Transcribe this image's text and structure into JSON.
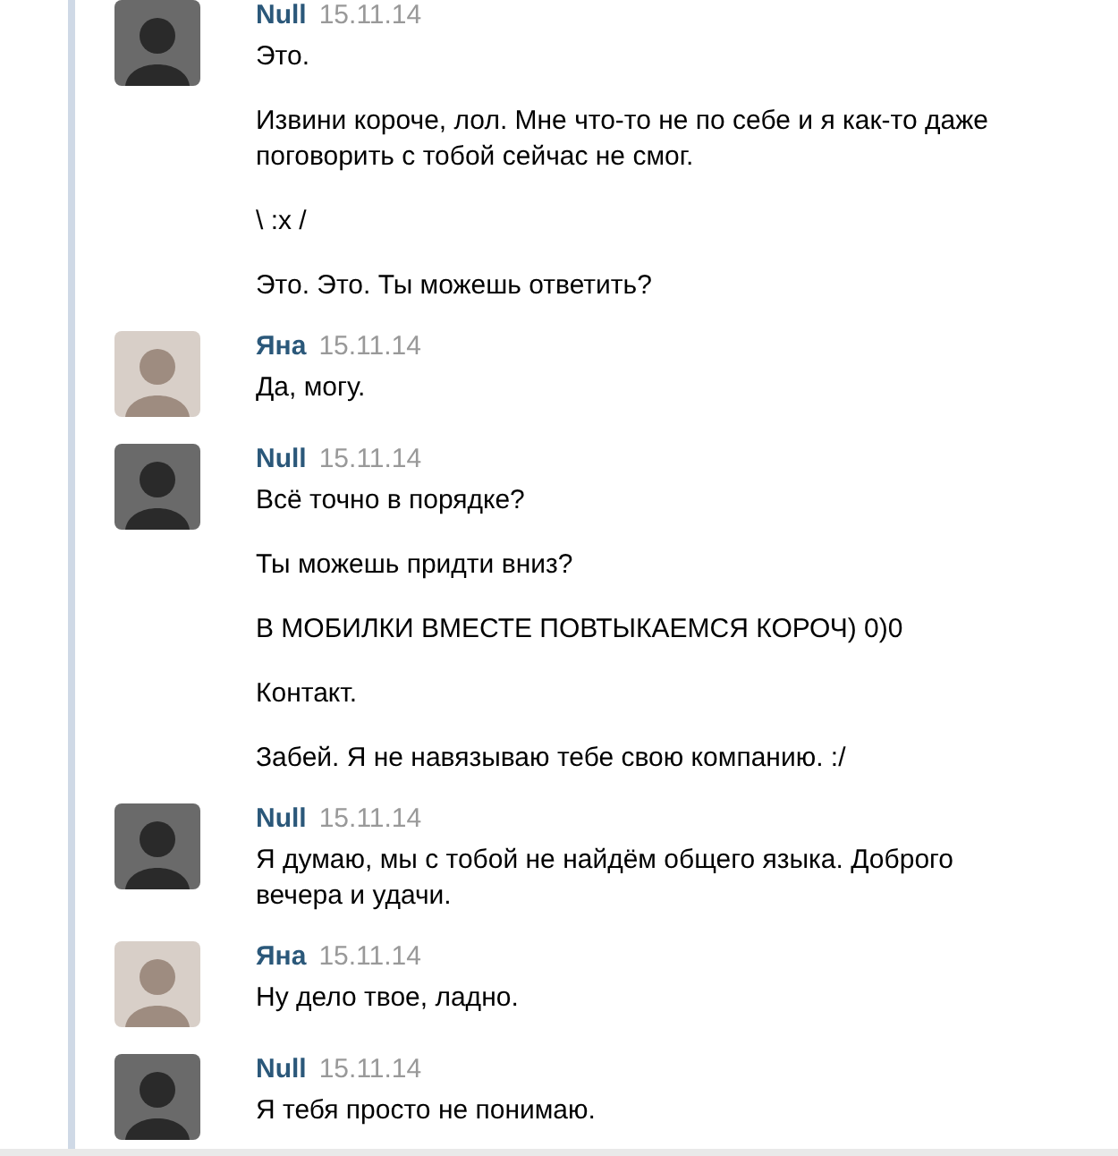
{
  "messages": [
    {
      "author": "Null",
      "date": "15.11.14",
      "kind": "dark",
      "paragraphs": [
        "Это.",
        "Извини короче, лол. Мне что-то не по себе и я как-то даже поговорить с тобой сейчас не смог.",
        "\\ :x /",
        "Это. Это. Ты можешь ответить?"
      ]
    },
    {
      "author": "Яна",
      "date": "15.11.14",
      "kind": "light",
      "paragraphs": [
        "Да, могу."
      ]
    },
    {
      "author": "Null",
      "date": "15.11.14",
      "kind": "dark",
      "paragraphs": [
        "Всё точно в порядке?",
        "Ты можешь придти вниз?",
        "В МОБИЛКИ ВМЕСТЕ ПОВТЫКАЕМСЯ КОРОЧ) 0)0",
        "Контакт.",
        "Забей. Я не навязываю тебе свою компанию. :/"
      ]
    },
    {
      "author": "Null",
      "date": "15.11.14",
      "kind": "dark",
      "paragraphs": [
        "Я думаю, мы с тобой не найдём общего языка. Доброго вечера и удачи."
      ]
    },
    {
      "author": "Яна",
      "date": "15.11.14",
      "kind": "light",
      "paragraphs": [
        "Ну дело твое, ладно."
      ]
    },
    {
      "author": "Null",
      "date": "15.11.14",
      "kind": "dark",
      "paragraphs": [
        "Я тебя просто не понимаю."
      ]
    }
  ]
}
